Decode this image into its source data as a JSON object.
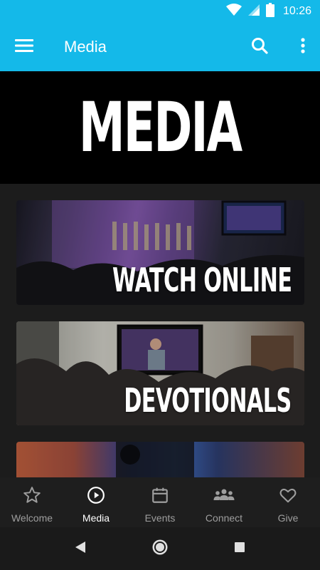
{
  "status_bar": {
    "time": "10:26"
  },
  "app_bar": {
    "title": "Media"
  },
  "hero": {
    "title": "MEDIA"
  },
  "cards": [
    {
      "label": "WATCH ONLINE"
    },
    {
      "label": "DEVOTIONALS"
    },
    {
      "label": ""
    }
  ],
  "bottom_nav": {
    "items": [
      {
        "label": "Welcome",
        "icon": "star-icon",
        "active": false
      },
      {
        "label": "Media",
        "icon": "play-circle-icon",
        "active": true
      },
      {
        "label": "Events",
        "icon": "calendar-icon",
        "active": false
      },
      {
        "label": "Connect",
        "icon": "group-icon",
        "active": false
      },
      {
        "label": "Give",
        "icon": "heart-icon",
        "active": false
      }
    ]
  },
  "colors": {
    "accent": "#14b9e9",
    "background": "#1c1c1c",
    "nav_inactive": "#9e9e9e",
    "nav_active": "#ffffff"
  }
}
